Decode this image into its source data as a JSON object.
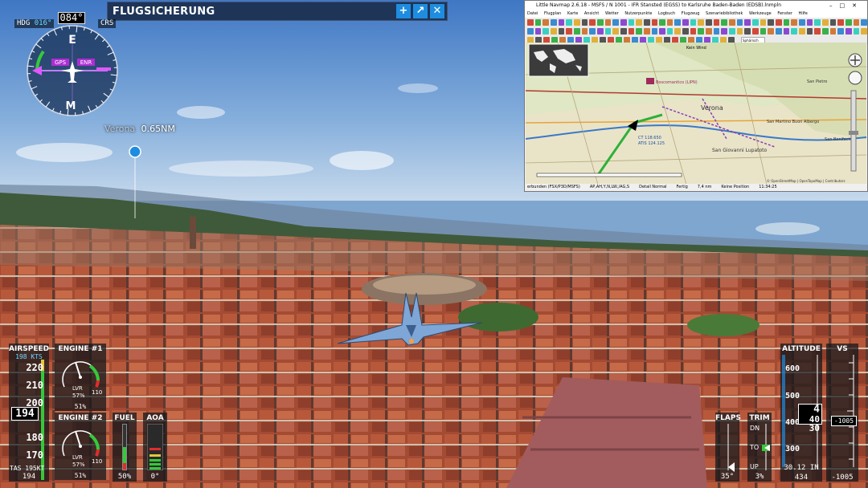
{
  "atc": {
    "title": "FLUGSICHERUNG",
    "buttons": {
      "add": "+",
      "undock": "↗",
      "close": "✕"
    }
  },
  "compass": {
    "hdg_label": "HDG",
    "hdg_bug": "016°",
    "crs_label": "CRS",
    "crs_value": "",
    "heading": "084°",
    "gps_badge": "GPS",
    "enr_badge": "ENR",
    "cardinals": [
      "E",
      "M"
    ],
    "heading_deg": 84
  },
  "waypoint": {
    "name": "Verona",
    "distance": "0.65NM"
  },
  "littlenavmap": {
    "title": "Little Navmap 2.6.18 - MSFS / N 1001 - IFR Stansted (EGSS) to Karlsruhe Baden-Baden (EDSB).lnmpln",
    "menu": [
      "Datei",
      "Flugplan",
      "Karte",
      "Ansicht",
      "Wetter",
      "Nutzerpunkte",
      "Logbuch",
      "Flugzeug",
      "Szenariebibliothek",
      "Werkzeuge",
      "Fenster",
      "Hilfe"
    ],
    "projection": "Sphärisch",
    "map_labels": {
      "city1": "Verona",
      "city2": "San Giovanni Lupatoto",
      "city3": "San Martino Buon Albergo",
      "city4": "San Bonifacio",
      "city5": "San Pietro",
      "airport": "Boscomantico (LIPN)",
      "freq1": "CT 118.650",
      "freq2": "ATIS 124.125",
      "wind": "Kein Wind"
    },
    "status": [
      "erbunden (FSX/P3D/MSFS)",
      "AP,AH,Y,N,LW,/AG,S",
      "Detail Normal",
      "Fertig",
      "7,4 nm",
      "Keine Position",
      "11:34:25"
    ],
    "copyright": "© OpenStreetMap | OpenTopoMap | Contributors"
  },
  "airspeed": {
    "label": "AIRSPEED",
    "kts": "198 KTS",
    "tape": [
      "220",
      "210",
      "200",
      "190",
      "180",
      "170"
    ],
    "ias": "194",
    "tas": "TAS 195KT",
    "gs": "194"
  },
  "engine1": {
    "label": "ENGINE #1",
    "lvr": "LVR",
    "lvr_pct": "57%",
    "max": "110",
    "n1": "51%",
    "needle": 0.51
  },
  "engine2": {
    "label": "ENGINE #2",
    "lvr": "LVR",
    "lvr_pct": "57%",
    "max": "110",
    "n1": "51%",
    "needle": 0.51
  },
  "fuel": {
    "label": "FUEL",
    "value": "50%",
    "level": 0.5
  },
  "aoa": {
    "label": "AOA",
    "value": "0°"
  },
  "flaps": {
    "label": "FLAPS",
    "value": "35°"
  },
  "trim": {
    "label": "TRIM",
    "dn": "DN",
    "to": "TO",
    "up": "UP",
    "value": "3%"
  },
  "altitude": {
    "label": "ALTITUDE",
    "tape": [
      "600",
      "500",
      "400",
      "300"
    ],
    "current_hi": "4",
    "current_lo": "40",
    "current_lo2": "30",
    "baro": "30.12 IN",
    "foot": "434"
  },
  "vs": {
    "label": "VS",
    "box": "-1005",
    "foot": "-1005"
  },
  "colors": {
    "accent": "#1e8de0",
    "hdg": "#6fd6ff",
    "crs": "#c27cff",
    "green": "#35c93a",
    "red": "#e02c2c",
    "amber": "#e8c43a"
  }
}
